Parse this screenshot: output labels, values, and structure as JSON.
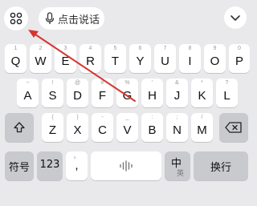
{
  "toolbar": {
    "menu_icon": "grid-menu-icon",
    "voice_icon": "microphone-icon",
    "voice_label": "点击说话",
    "collapse_icon": "chevron-down-icon"
  },
  "rows": {
    "row1": [
      {
        "hint": "1",
        "label": "Q"
      },
      {
        "hint": "2",
        "label": "W"
      },
      {
        "hint": "3",
        "label": "E"
      },
      {
        "hint": "4",
        "label": "R"
      },
      {
        "hint": "5",
        "label": "T"
      },
      {
        "hint": "6",
        "label": "Y"
      },
      {
        "hint": "7",
        "label": "U"
      },
      {
        "hint": "8",
        "label": "I"
      },
      {
        "hint": "9",
        "label": "O"
      },
      {
        "hint": "0",
        "label": "P"
      }
    ],
    "row2": [
      {
        "hint": "~",
        "label": "A"
      },
      {
        "hint": "!",
        "label": "S"
      },
      {
        "hint": "@",
        "label": "D"
      },
      {
        "hint": "#",
        "label": "F"
      },
      {
        "hint": "%",
        "label": "G"
      },
      {
        "hint": "'",
        "label": "H"
      },
      {
        "hint": "&",
        "label": "J"
      },
      {
        "hint": "*",
        "label": "K"
      },
      {
        "hint": "?",
        "label": "L"
      }
    ],
    "row3": [
      {
        "hint": "(",
        "label": "Z"
      },
      {
        "hint": ")",
        "label": "X"
      },
      {
        "hint": "-",
        "label": "C"
      },
      {
        "hint": "_",
        "label": "V"
      },
      {
        "hint": ":",
        "label": "B"
      },
      {
        "hint": ";",
        "label": "N"
      },
      {
        "hint": "/",
        "label": "M"
      }
    ]
  },
  "bottom": {
    "symbols_label": "符号",
    "numbers_label": "123",
    "comma_hint": "。",
    "comma_label": ",",
    "space_icon": "voice-wave-icon",
    "mode_primary": "中",
    "mode_secondary": "英",
    "enter_label": "换行"
  },
  "icons": {
    "shift": "shift-icon",
    "backspace": "backspace-icon"
  },
  "colors": {
    "background": "#e9e9ec",
    "key": "#ffffff",
    "function_key": "#c9cace",
    "annotation_arrow": "#d8342c"
  }
}
